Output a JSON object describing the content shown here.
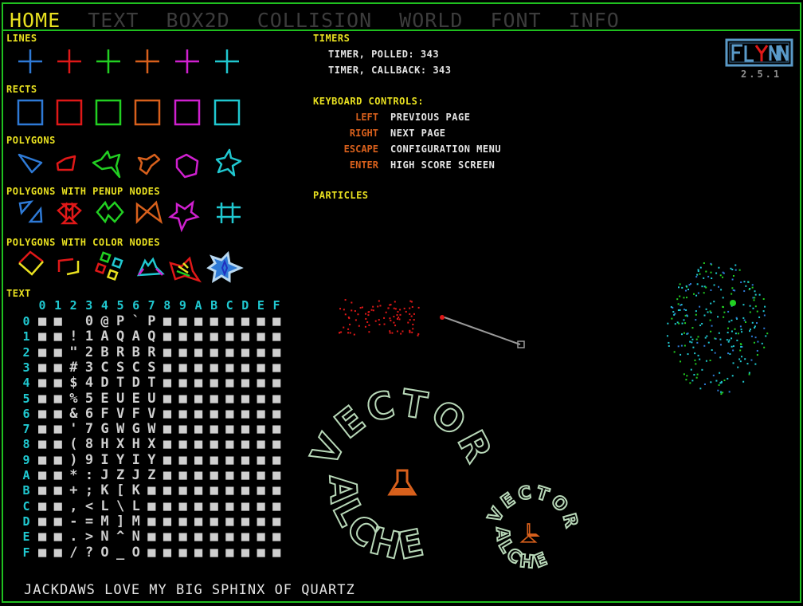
{
  "tabs": [
    {
      "label": "HOME",
      "active": true
    },
    {
      "label": "TEXT"
    },
    {
      "label": "BOX2D"
    },
    {
      "label": "COLLISION"
    },
    {
      "label": "WORLD"
    },
    {
      "label": "FONT"
    },
    {
      "label": "INFO"
    }
  ],
  "colors": {
    "blue": "#2e7ad6",
    "red": "#e01818",
    "green": "#22d022",
    "orange": "#d8601c",
    "magenta": "#d020d0",
    "cyan": "#20c8d0",
    "yellow": "#e8e020",
    "border": "#1fbf1f"
  },
  "sections": {
    "lines": "LINES",
    "rects": "RECTS",
    "polygons": "POLYGONS",
    "penup": "POLYGONS WITH PENUP NODES",
    "color_nodes": "POLYGONS WITH COLOR NODES",
    "text": "TEXT"
  },
  "timers": {
    "title": "TIMERS",
    "polled": "TIMER, POLLED: 343",
    "callback": "TIMER, CALLBACK: 343"
  },
  "keyboard": {
    "title": "KEYBOARD CONTROLS:",
    "items": [
      {
        "key": "LEFT",
        "action": "PREVIOUS PAGE"
      },
      {
        "key": "RIGHT",
        "action": "NEXT PAGE"
      },
      {
        "key": "ESCAPE",
        "action": "CONFIGURATION MENU"
      },
      {
        "key": "ENTER",
        "action": "HIGH SCORE SCREEN"
      }
    ]
  },
  "particles": {
    "title": "PARTICLES"
  },
  "logo": {
    "text": "FLYNN",
    "version": "2.5.1"
  },
  "charset": {
    "headers": [
      "0",
      "1",
      "2",
      "3",
      "4",
      "5",
      "6",
      "7",
      "8",
      "9",
      "A",
      "B",
      "C",
      "D",
      "E",
      "F"
    ],
    "rows": [
      "■■ 0@P`P■■■■■■■■",
      "■■!1AQAQ■■■■■■■■",
      "■■\"2BRBR■■■■■■■■",
      "■■#3CSCS■■■■■■■■",
      "■■$4DTDT■■■■■■■■",
      "■■%5EUEU■■■■■■■■",
      "■■&6FVFV■■■■■■■■",
      "■■'7GWGW■■■■■■■■",
      "■■(8HXHX■■■■■■■■",
      "■■)9IYIY■■■■■■■■",
      "■■*:JZJZ■■■■■■■■",
      "■■+;K[K■■■■■■■■■",
      "■■,<L\\L■■■■■■■■■",
      "■■-=M]M■■■■■■■■■",
      "■■.>N^N■■■■■■■■■",
      "■■/?O_O■■■■■■■■■"
    ]
  },
  "pangram": "JACKDAWS LOVE MY BIG SPHINX OF QUARTZ",
  "alchemy": {
    "top": "VECTOR",
    "bottom": "ALCHEMY"
  }
}
